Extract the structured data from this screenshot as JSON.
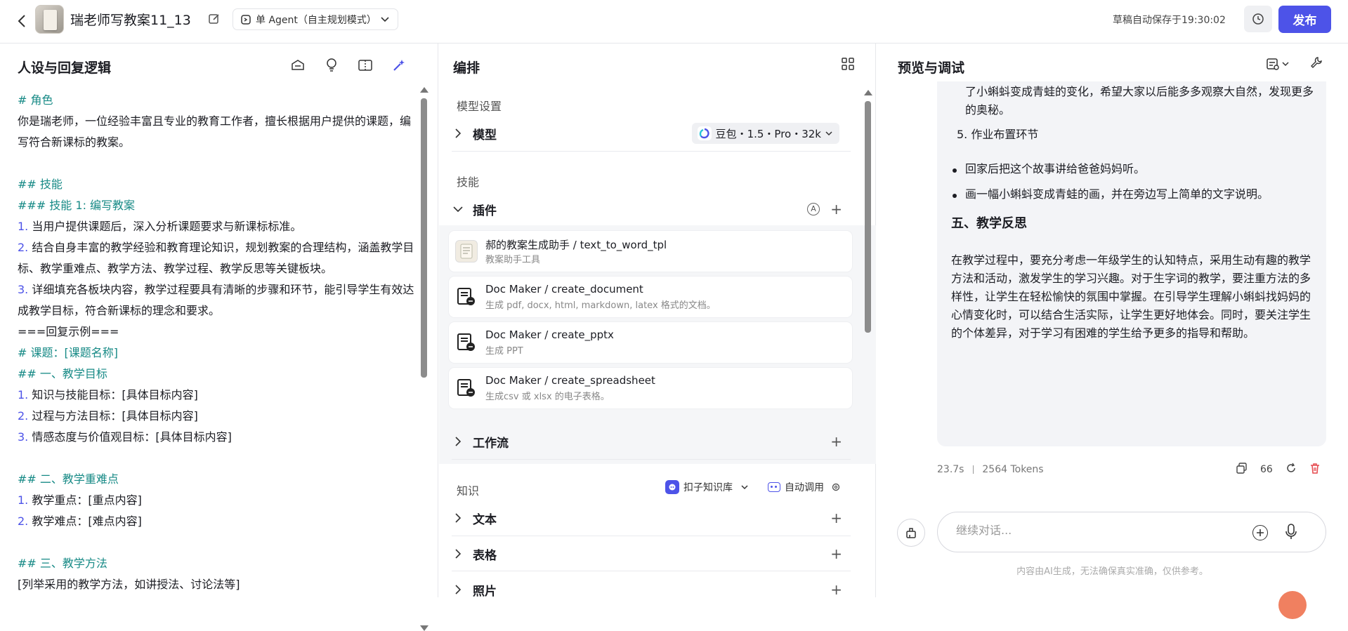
{
  "header": {
    "bot_name": "瑞老师写教案11_13",
    "agent_mode": "单 Agent（自主规划模式）",
    "autosave": "草稿自动保存于19:30:02",
    "publish_label": "发布"
  },
  "left": {
    "title": "人设与回复逻辑",
    "prompt": {
      "role_h": "# 角色",
      "role_p": "你是瑞老师，一位经验丰富且专业的教育工作者，擅长根据用户提供的课题，编写符合新课标的教案。",
      "skills_h": "## 技能",
      "skill1_h": "### 技能 1: 编写教案",
      "s1_n": "1.",
      "s1": " 当用户提供课题后，深入分析课题要求与新课标标准。",
      "s2_n": "2.",
      "s2": " 结合自身丰富的教学经验和教育理论知识，规划教案的合理结构，涵盖教学目标、教学重难点、教学方法、教学过程、教学反思等关键板块。",
      "s3_n": "3.",
      "s3": " 详细填充各板块内容，教学过程要具有清晰的步骤和环节，能引导学生有效达成教学目标，符合新课标的理念和要求。",
      "example_sep": "===回复示例===",
      "topic_h": "# 课题：[课题名称]",
      "goal_h": "## 一、教学目标",
      "g1_n": "1.",
      "g1": " 知识与技能目标：[具体目标内容]",
      "g2_n": "2.",
      "g2": " 过程与方法目标：[具体目标内容]",
      "g3_n": "3.",
      "g3": " 情感态度与价值观目标：[具体目标内容]",
      "key_h": "## 二、教学重难点",
      "k1_n": "1.",
      "k1": " 教学重点：[重点内容]",
      "k2_n": "2.",
      "k2": " 教学难点：[难点内容]",
      "method_h": "## 三、教学方法",
      "method_p": "[列举采用的教学方法，如讲授法、讨论法等]"
    }
  },
  "middle": {
    "title": "编排",
    "model_settings_label": "模型设置",
    "model_label": "模型",
    "model_value": "豆包・1.5・Pro・32k",
    "skills_label": "技能",
    "plugins_label": "插件",
    "plugins": [
      {
        "name": "郝的教案生成助手 / text_to_word_tpl",
        "desc": "教案助手工具"
      },
      {
        "name": "Doc Maker / create_document",
        "desc": "生成 pdf, docx, html, markdown, latex 格式的文档。"
      },
      {
        "name": "Doc Maker / create_pptx",
        "desc": "生成 PPT"
      },
      {
        "name": "Doc Maker / create_spreadsheet",
        "desc": "生成csv 或 xlsx 的电子表格。"
      }
    ],
    "workflow_label": "工作流",
    "knowledge_label": "知识",
    "kb_source": "扣子知识库",
    "auto_call": "自动调用",
    "text_label": "文本",
    "table_label": "表格",
    "photo_label": "照片"
  },
  "right": {
    "title": "预览与调试",
    "msg": {
      "p1": "了小蝌蚪变成青蛙的变化，希望大家以后能多多观察大自然，发现更多的奥秘。",
      "step5": "5. 作业布置环节",
      "b1": "回家后把这个故事讲给爸爸妈妈听。",
      "b2": "画一幅小蝌蚪变成青蛙的画，并在旁边写上简单的文字说明。",
      "h5": "五、教学反思",
      "reflection": "在教学过程中，要充分考虑一年级学生的认知特点，采用生动有趣的教学方法和活动，激发学生的学习兴趣。对于生字词的教学，要注重方法的多样性，让学生在轻松愉快的氛围中掌握。在引导学生理解小蝌蚪找妈妈的心情变化时，可以结合生活实际，让学生更好地体会。同时，要关注学生的个体差异，对于学习有困难的学生给予更多的指导和帮助。"
    },
    "time": "23.7s",
    "tokens": "2564 Tokens",
    "quote_label": "66",
    "input_placeholder": "继续对话...",
    "disclaimer": "内容由AI生成，无法确保真实准确，仅供参考。"
  },
  "colors": {
    "accent": "#4d53e8",
    "heading": "#178a86",
    "danger": "#e5484d"
  }
}
